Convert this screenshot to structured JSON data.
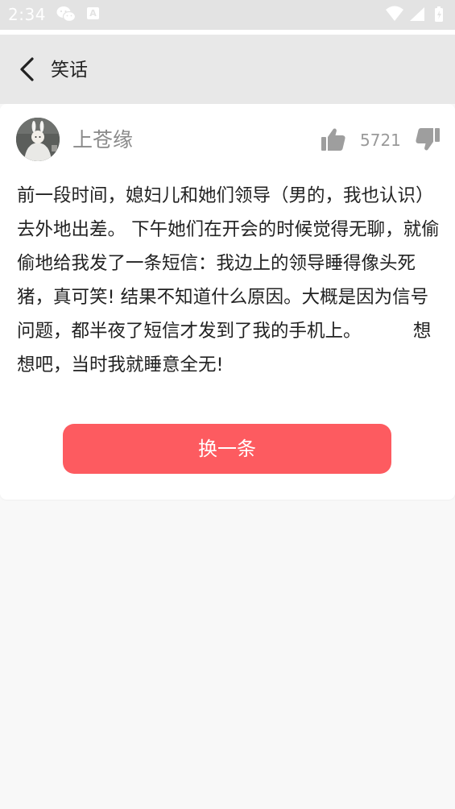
{
  "status_bar": {
    "time": "2:34",
    "icons": [
      "wechat-icon",
      "a-icon",
      "wifi-icon",
      "cellular-signal-icon",
      "battery-icon"
    ],
    "a_glyph": "A"
  },
  "app_bar": {
    "title": "笑话",
    "back_icon": "chevron-left-icon"
  },
  "joke": {
    "author": "上苍缘",
    "like_count": "5721",
    "like_icon": "thumbs-up-icon",
    "dislike_icon": "thumbs-down-icon",
    "text": "前一段时间，媳妇儿和她们领导（男的，我也认识）去外地出差。 下午她们在开会的时候觉得无聊，就偷偷地给我发了一条短信：我边上的领导睡得像头死猪，真可笑! 结果不知道什么原因。大概是因为信号问题，都半夜了短信才发到了我的手机上。         想想吧，当时我就睡意全无!"
  },
  "actions": {
    "next_label": "换一条"
  },
  "colors": {
    "status_bar_bg": "#e3e3e3",
    "app_bar_bg": "#e8e8e8",
    "page_bg": "#f8f8f8",
    "card_bg": "#ffffff",
    "accent": "#fd5b60",
    "icon_gray": "#9e9e9e"
  }
}
